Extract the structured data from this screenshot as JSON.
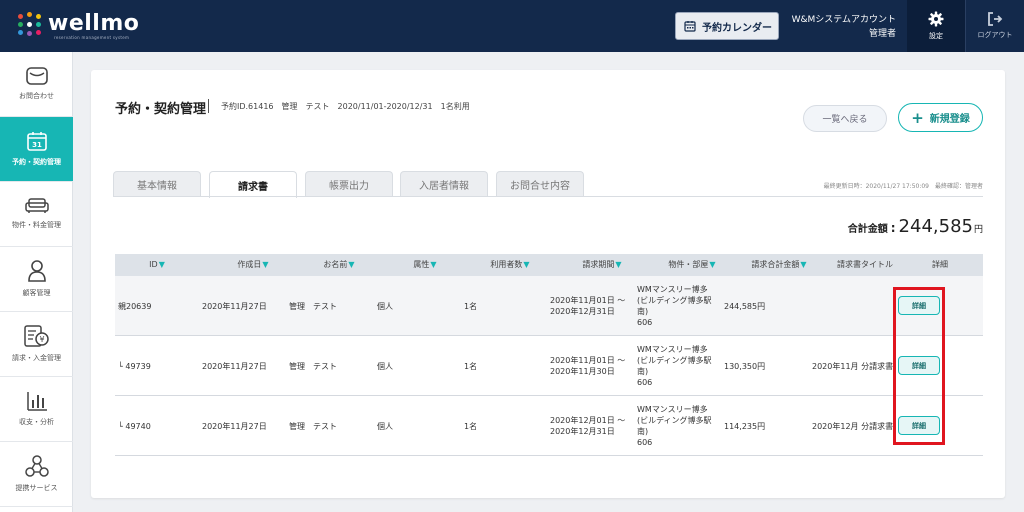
{
  "header": {
    "logo_text": "wellmo",
    "logo_sub": "reservation management system",
    "calendar_button": "予約カレンダー",
    "account_name": "W&Mシステムアカウント",
    "account_role": "管理者",
    "settings_label": "設定",
    "logout_label": "ログアウト"
  },
  "sidebar": {
    "items": [
      {
        "label": "お問合わせ",
        "icon": "envelope-icon"
      },
      {
        "label": "予約・契約管理",
        "icon": "calendar-icon",
        "active": true
      },
      {
        "label": "物件・料金管理",
        "icon": "sofa-icon"
      },
      {
        "label": "顧客管理",
        "icon": "person-icon"
      },
      {
        "label": "請求・入金管理",
        "icon": "invoice-yen-icon"
      },
      {
        "label": "収支・分析",
        "icon": "bar-chart-icon"
      },
      {
        "label": "提携サービス",
        "icon": "network-icon"
      }
    ]
  },
  "page": {
    "title": "予約・契約管理",
    "meta": "予約ID.61416　管理　テスト　2020/11/01-2020/12/31　1名利用",
    "back_button": "一覧へ戻る",
    "new_button": "新規登録",
    "update_info": "最終更新日時：2020/11/27 17:50:09　最終確認：管理者",
    "total_label": "合計金額",
    "total_amount": "244,585",
    "total_unit": "円"
  },
  "tabs": [
    {
      "label": "基本情報",
      "active": false
    },
    {
      "label": "請求書",
      "active": true
    },
    {
      "label": "帳票出力",
      "active": false
    },
    {
      "label": "入居者情報",
      "active": false
    },
    {
      "label": "お問合せ内容",
      "active": false
    }
  ],
  "table": {
    "columns": [
      "ID",
      "作成日",
      "お名前",
      "属性",
      "利用者数",
      "請求期間",
      "物件・部屋",
      "請求合計金額",
      "請求書タイトル",
      "詳細"
    ],
    "rows": [
      {
        "id": "親20639",
        "created": "2020年11月27日",
        "name": "管理　テスト",
        "attr": "個人",
        "users": "1名",
        "period1": "2020年11月01日 〜",
        "period2": "2020年12月31日",
        "prop1": "WMマンスリー博多",
        "prop2": "(ビルディング博多駅",
        "prop3": "南)",
        "prop4": "606",
        "amount": "244,585円",
        "title": "",
        "detail": "詳細"
      },
      {
        "id": "└ 49739",
        "created": "2020年11月27日",
        "name": "管理　テスト",
        "attr": "個人",
        "users": "1名",
        "period1": "2020年11月01日 〜",
        "period2": "2020年11月30日",
        "prop1": "WMマンスリー博多",
        "prop2": "(ビルディング博多駅",
        "prop3": "南)",
        "prop4": "606",
        "amount": "130,350円",
        "title": "2020年11月 分請求書",
        "detail": "詳細"
      },
      {
        "id": "└ 49740",
        "created": "2020年11月27日",
        "name": "管理　テスト",
        "attr": "個人",
        "users": "1名",
        "period1": "2020年12月01日 〜",
        "period2": "2020年12月31日",
        "prop1": "WMマンスリー博多",
        "prop2": "(ビルディング博多駅",
        "prop3": "南)",
        "prop4": "606",
        "amount": "114,235円",
        "title": "2020年12月 分請求書",
        "detail": "詳細"
      }
    ]
  },
  "colors": {
    "header_bg": "#13294b",
    "accent": "#17b6b4",
    "highlight": "#e0151f"
  }
}
